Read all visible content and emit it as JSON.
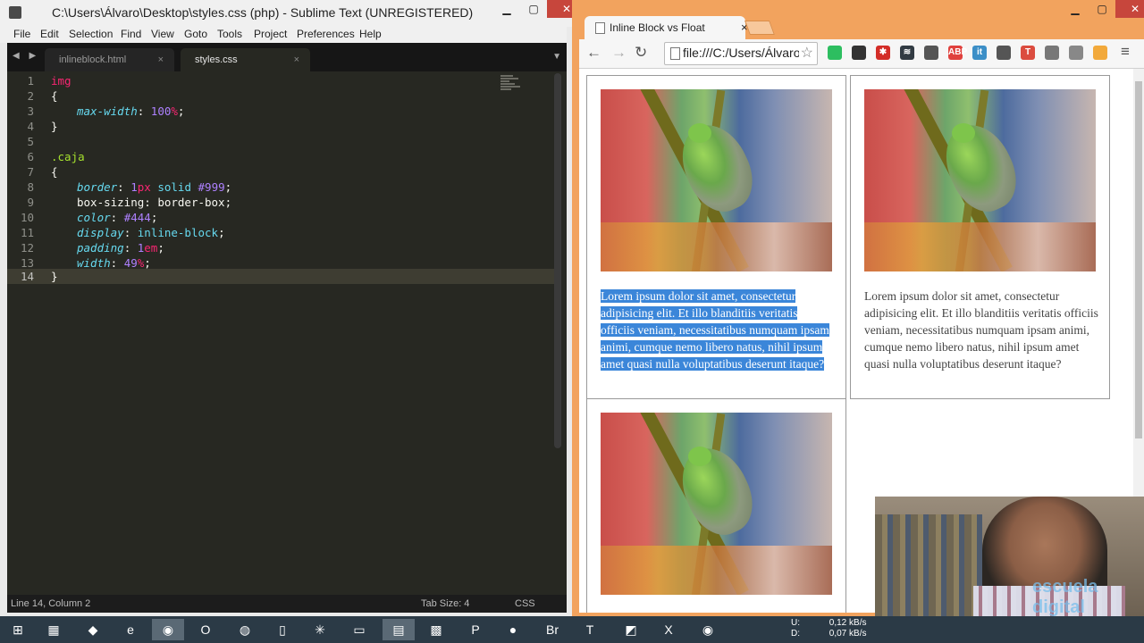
{
  "sublime": {
    "title": "C:\\Users\\Álvaro\\Desktop\\styles.css (php) - Sublime Text (UNREGISTERED)",
    "window_buttons": {
      "minimize": "▁",
      "maximize": "▢",
      "close": "✕"
    },
    "menu": [
      "File",
      "Edit",
      "Selection",
      "Find",
      "View",
      "Goto",
      "Tools",
      "Project",
      "Preferences",
      "Help"
    ],
    "tabs": [
      {
        "label": "inlineblock.html",
        "close": "×"
      },
      {
        "label": "styles.css",
        "close": "×"
      }
    ],
    "tab_arrows": "◀ ▶",
    "tab_dropdown": "▼",
    "line_numbers": [
      "1",
      "2",
      "3",
      "4",
      "5",
      "6",
      "7",
      "8",
      "9",
      "10",
      "11",
      "12",
      "13",
      "14"
    ],
    "code": {
      "l1_selector": "img",
      "l2_brace": "{",
      "l3_prop": "max-width",
      "l3_num": "100",
      "l3_unit": "%",
      "l4_brace": "}",
      "l6_selector": ".caja",
      "l7_brace": "{",
      "l8_prop": "border",
      "l8_num": "1",
      "l8_unit": "px",
      "l8_kw": "solid",
      "l8_color": "#999",
      "l9_prop": "box-sizing",
      "l9_value": "border-box",
      "l10_prop": "color",
      "l10_color": "#444",
      "l11_prop": "display",
      "l11_value": "inline-block",
      "l12_prop": "padding",
      "l12_num": "1",
      "l12_unit": "em",
      "l13_prop": "width",
      "l13_num": "49",
      "l13_unit": "%",
      "l14_brace": "}"
    },
    "status": {
      "position": "Line 14, Column 2",
      "tab_size": "Tab Size: 4",
      "syntax": "CSS"
    }
  },
  "chrome": {
    "tab_title": "Inline Block vs Float",
    "tab_close": "×",
    "window_buttons": {
      "minimize": "▁",
      "maximize": "▢",
      "close": "✕"
    },
    "nav": {
      "back": "←",
      "forward": "→",
      "reload": "↻"
    },
    "url": "file:///C:/Users/Álvaro/Desktop/inlineblock.html",
    "star": "☆",
    "menu_icon": "≡",
    "extensions": [
      {
        "name": "evernote-icon",
        "color": "#2dbe60",
        "glyph": ""
      },
      {
        "name": "chrome-ext-icon",
        "color": "#333333",
        "glyph": ""
      },
      {
        "name": "lastpass-icon",
        "color": "#d32d27",
        "glyph": "✱"
      },
      {
        "name": "buffer-icon",
        "color": "#323b43",
        "glyph": "≋"
      },
      {
        "name": "puzzle-icon",
        "color": "#555555",
        "glyph": ""
      },
      {
        "name": "adblock-icon",
        "color": "#e0413d",
        "glyph": "ABP"
      },
      {
        "name": "scoopit-icon",
        "color": "#3c8fc7",
        "glyph": "it"
      },
      {
        "name": "tools-icon",
        "color": "#555555",
        "glyph": ""
      },
      {
        "name": "todoist-icon",
        "color": "#db4c3f",
        "glyph": "T"
      },
      {
        "name": "pocket-icon",
        "color": "#777777",
        "glyph": ""
      },
      {
        "name": "gmail-icon",
        "color": "#888888",
        "glyph": ""
      },
      {
        "name": "off-icon",
        "color": "#f2a93b",
        "glyph": ""
      }
    ],
    "boxes": [
      {
        "text": "Lorem ipsum dolor sit amet, consectetur adipisicing elit. Et illo blanditiis veritatis officiis veniam, necessitatibus numquam ipsam animi, cumque nemo libero natus, nihil ipsum amet quasi nulla voluptatibus deserunt itaque?",
        "selected": true
      },
      {
        "text": "Lorem ipsum dolor sit amet, consectetur adipisicing elit. Et illo blanditiis veritatis officiis veniam, necessitatibus numquam ipsam animi, cumque nemo libero natus, nihil ipsum amet quasi nulla voluptatibus deserunt itaque?",
        "selected": false
      }
    ]
  },
  "webcam": {
    "brand": "escuela digital"
  },
  "taskbar": {
    "items": [
      {
        "name": "windows-start-icon",
        "glyph": "⊞"
      },
      {
        "name": "apps-icon",
        "glyph": "▦"
      },
      {
        "name": "app-green-icon",
        "glyph": "◆"
      },
      {
        "name": "ie-icon",
        "glyph": "e"
      },
      {
        "name": "chrome-icon",
        "glyph": "◉"
      },
      {
        "name": "opera-icon",
        "glyph": "O"
      },
      {
        "name": "firefox-icon",
        "glyph": "◍"
      },
      {
        "name": "phone-icon",
        "glyph": "▯"
      },
      {
        "name": "asterisk-icon",
        "glyph": "✳"
      },
      {
        "name": "folder-icon",
        "glyph": "▭"
      },
      {
        "name": "sublime-icon",
        "glyph": "▤"
      },
      {
        "name": "windows-apps-icon",
        "glyph": "▩"
      },
      {
        "name": "powerpoint-icon",
        "glyph": "P"
      },
      {
        "name": "skype-icon",
        "glyph": "●"
      },
      {
        "name": "bridge-icon",
        "glyph": "Br"
      },
      {
        "name": "todoist-icon",
        "glyph": "T"
      },
      {
        "name": "camtasia-icon",
        "glyph": "◩"
      },
      {
        "name": "excel-icon",
        "glyph": "X"
      },
      {
        "name": "chrome2-icon",
        "glyph": "◉"
      }
    ],
    "tray": {
      "up_label": "U:",
      "up": "0,12 kB/s",
      "down_label": "D:",
      "down": "0,07 kB/s"
    }
  }
}
